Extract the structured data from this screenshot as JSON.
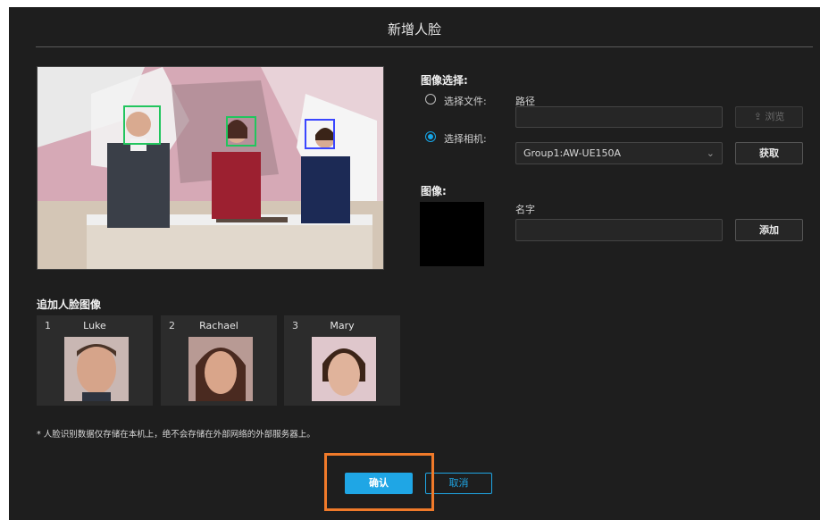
{
  "dialog": {
    "title": "新增人脸",
    "image_selection_label": "图像选择:",
    "select_file_label": "选择文件:",
    "select_camera_label": "选择相机:",
    "path_label": "路径",
    "path_value": "",
    "browse_button": "浏览",
    "camera_value": "Group1:AW-UE150A",
    "get_button": "获取",
    "image_label": "图像:",
    "name_label": "名字",
    "name_value": "",
    "add_button": "添加",
    "additional_faces_label": "追加人脸图像",
    "faces": [
      {
        "num": "1",
        "name": "Luke"
      },
      {
        "num": "2",
        "name": "Rachael"
      },
      {
        "num": "3",
        "name": "Mary"
      }
    ],
    "note": "* 人脸识别数据仅存储在本机上，绝不会存储在外部网络的外部服务器上。",
    "confirm_button": "确认",
    "cancel_button": "取消",
    "selected_source": "camera",
    "accent_color": "#1fa6e5",
    "highlight_color": "#f07a2a",
    "face_box_colors": [
      "#22c55e",
      "#22c55e",
      "#3a46ff"
    ]
  }
}
